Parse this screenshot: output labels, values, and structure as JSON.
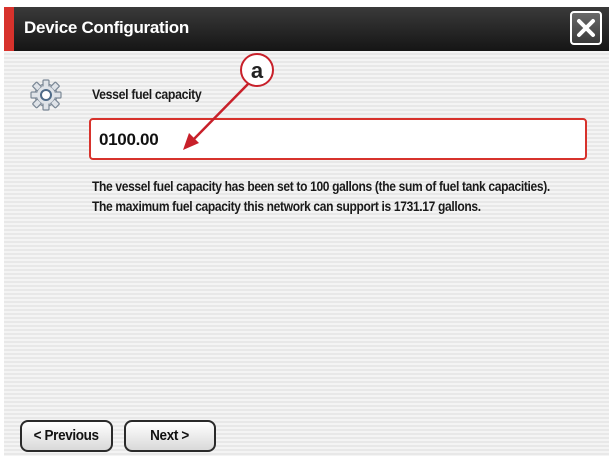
{
  "window": {
    "title": "Device Configuration"
  },
  "field": {
    "label": "Vessel fuel capacity",
    "value": "0100.00"
  },
  "description": {
    "line1": "The vessel fuel capacity has been set to  100 gallons (the sum of fuel tank capacities).",
    "line2": "The maximum fuel capacity this network can support is 1731.17 gallons."
  },
  "callout": {
    "letter": "a"
  },
  "buttons": {
    "previous": "< Previous",
    "next": "Next >"
  },
  "colors": {
    "accent": "#d7322c",
    "titlebar": "#1f1f1f"
  },
  "icons": {
    "settings": "gear-icon",
    "close": "close-icon"
  }
}
